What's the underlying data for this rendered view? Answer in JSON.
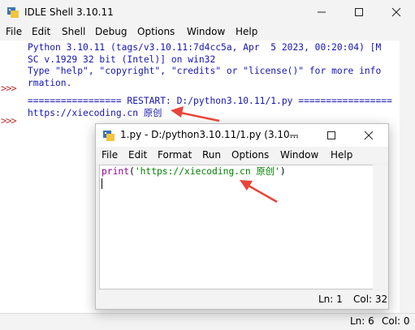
{
  "shell": {
    "title": "IDLE Shell 3.10.11",
    "menu": [
      "File",
      "Edit",
      "Shell",
      "Debug",
      "Options",
      "Window",
      "Help"
    ],
    "prompt": ">>>",
    "lines": [
      "Python 3.10.11 (tags/v3.10.11:7d4cc5a, Apr  5 2023, 00:20:04) [M",
      "SC v.1929 32 bit (Intel)] on win32",
      "Type \"help\", \"copyright\", \"credits\" or \"license()\" for more info",
      "rmation.",
      "",
      "================= RESTART: D:/python3.10.11/1.py =================",
      "https://xiecoding.cn 原创"
    ],
    "status": {
      "ln": "Ln: 6",
      "col": "Col: 0"
    }
  },
  "editor": {
    "title": "1.py - D:/python3.10.11/1.py (3.10...",
    "menu": [
      "File",
      "Edit",
      "Format",
      "Run",
      "Options",
      "Window",
      "Help"
    ],
    "code": {
      "func": "print",
      "open": "(",
      "string": "'https://xiecoding.cn 原创'",
      "close": ")"
    },
    "status": {
      "ln": "Ln: 1",
      "col": "Col: 32"
    }
  },
  "colors": {
    "annotation_arrow": "#e8463a",
    "prompt": "#b33333",
    "output": "#1515b5",
    "keyword": "#900090",
    "string": "#008000"
  },
  "icons": {
    "app": "idle-python-icon",
    "minimize": "minimize-icon",
    "maximize": "maximize-icon",
    "close": "close-icon"
  }
}
